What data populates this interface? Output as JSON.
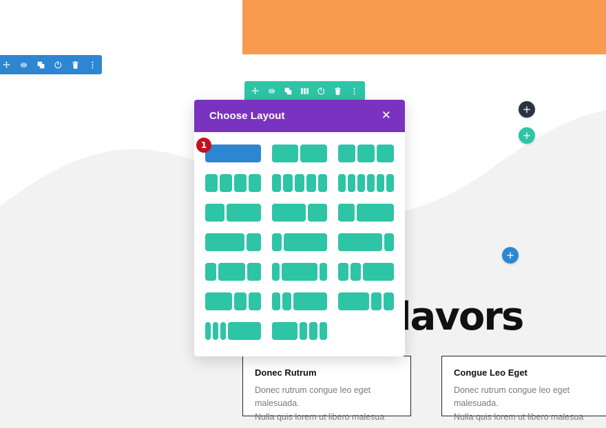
{
  "page": {
    "headline": "flavors",
    "colors": {
      "orange_block": "#f89b4e",
      "teal_accent": "#2ec4a6",
      "blue_accent": "#2d86d2",
      "purple_header": "#7a33c1",
      "badge_red": "#c1121f",
      "dark_button": "#2b3343",
      "page_background": "#ffffff",
      "wave_fill": "#f2f2f2"
    }
  },
  "section_toolbar": {
    "name": "section-toolbar",
    "color": "#2d86d2",
    "icons": [
      {
        "name": "move-icon",
        "label": "Move"
      },
      {
        "name": "gear-icon",
        "label": "Settings"
      },
      {
        "name": "duplicate-icon",
        "label": "Duplicate"
      },
      {
        "name": "power-icon",
        "label": "Disable"
      },
      {
        "name": "trash-icon",
        "label": "Delete"
      },
      {
        "name": "more-vertical-icon",
        "label": "More options"
      }
    ]
  },
  "row_toolbar": {
    "name": "row-toolbar",
    "color": "#2ec4a6",
    "icons": [
      {
        "name": "move-icon",
        "label": "Move"
      },
      {
        "name": "gear-icon",
        "label": "Settings"
      },
      {
        "name": "duplicate-icon",
        "label": "Duplicate"
      },
      {
        "name": "columns-icon",
        "label": "Change Column Structure"
      },
      {
        "name": "power-icon",
        "label": "Disable"
      },
      {
        "name": "trash-icon",
        "label": "Delete"
      },
      {
        "name": "more-vertical-icon",
        "label": "More options"
      }
    ]
  },
  "floating_buttons": [
    {
      "name": "add-section-dark-button",
      "icon": "plus-icon",
      "glyph": "+",
      "color": "#2b3343"
    },
    {
      "name": "add-row-teal-button",
      "icon": "plus-icon",
      "glyph": "+",
      "color": "#2ec4a6"
    },
    {
      "name": "add-section-blue-button",
      "icon": "plus-icon",
      "glyph": "+",
      "color": "#2d86d2"
    }
  ],
  "modal": {
    "title": "Choose Layout",
    "close_label": "✕",
    "selected_index": 0,
    "selected_badge": "1",
    "layouts": [
      {
        "name": "layout-1-col",
        "widths": [
          100
        ]
      },
      {
        "name": "layout-2-col",
        "widths": [
          50,
          50
        ]
      },
      {
        "name": "layout-3-col",
        "widths": [
          33.33,
          33.33,
          33.33
        ]
      },
      {
        "name": "layout-4-col",
        "widths": [
          25,
          25,
          25,
          25
        ]
      },
      {
        "name": "layout-5-col",
        "widths": [
          20,
          20,
          20,
          20,
          20
        ]
      },
      {
        "name": "layout-6-col",
        "widths": [
          16.66,
          16.66,
          16.66,
          16.66,
          16.66,
          16.66
        ]
      },
      {
        "name": "layout-third-twothirds",
        "widths": [
          36,
          64
        ]
      },
      {
        "name": "layout-twothirds-third",
        "widths": [
          64,
          36
        ]
      },
      {
        "name": "layout-quarter-threequarters",
        "widths": [
          30,
          70
        ]
      },
      {
        "name": "layout-threequarters-quarter",
        "widths": [
          73,
          27
        ]
      },
      {
        "name": "layout-quarter-threequarters-b",
        "widths": [
          18,
          82
        ]
      },
      {
        "name": "layout-threequarters-quarter-b",
        "widths": [
          82,
          18
        ]
      },
      {
        "name": "layout-quarter-half-quarter",
        "widths": [
          22,
          52,
          26
        ]
      },
      {
        "name": "layout-fifth-threefifths-fifth",
        "widths": [
          15,
          70,
          15
        ]
      },
      {
        "name": "layout-quarter-quarter-half",
        "widths": [
          20,
          20,
          60
        ]
      },
      {
        "name": "layout-half-quarter-quarter",
        "widths": [
          52,
          24,
          24
        ]
      },
      {
        "name": "layout-quarter-quarter-half-b",
        "widths": [
          17,
          17,
          66
        ]
      },
      {
        "name": "layout-half-quarter-quarter-b",
        "widths": [
          60,
          20,
          20
        ]
      },
      {
        "name": "layout-sixth-sixth-sixth-half",
        "widths": [
          11,
          11,
          11,
          67
        ]
      },
      {
        "name": "layout-half-sixth-sixth-sixth",
        "widths": [
          52,
          16,
          16,
          16
        ]
      }
    ]
  },
  "blurbs": [
    {
      "name": "blurb-donec-rutrum",
      "title": "Donec Rutrum",
      "line1": "Donec rutrum congue leo eget malesuada.",
      "line2": "Nulla quis lorem ut libero malesua"
    },
    {
      "name": "blurb-congue-leo-eget",
      "title": "Congue Leo Eget",
      "line1": "Donec rutrum congue leo eget malesuada.",
      "line2": "Nulla quis lorem ut libero malesua"
    }
  ]
}
